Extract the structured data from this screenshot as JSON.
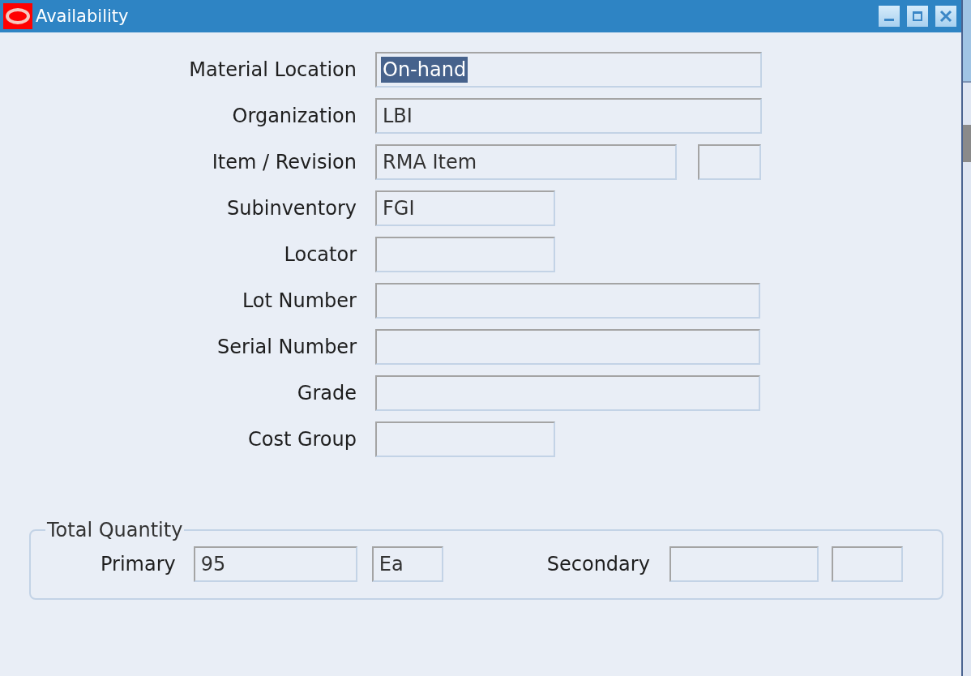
{
  "window": {
    "title": "Availability"
  },
  "fields": [
    {
      "label": "Material Location",
      "value": "On-hand",
      "text_selected": true
    },
    {
      "label": "Organization",
      "value": "LBI"
    },
    {
      "label": "Item / Revision",
      "value": "RMA Item",
      "extra": true
    },
    {
      "label": "Subinventory",
      "value": "FGI"
    },
    {
      "label": "Locator"
    },
    {
      "label": "Lot Number"
    },
    {
      "label": "Serial Number"
    },
    {
      "label": "Grade"
    },
    {
      "label": "Cost Group"
    }
  ],
  "total_quantity": {
    "title": "Total Quantity",
    "primary_label": "Primary",
    "primary_value": "95",
    "primary_uom": "Ea",
    "secondary_label": "Secondary"
  }
}
